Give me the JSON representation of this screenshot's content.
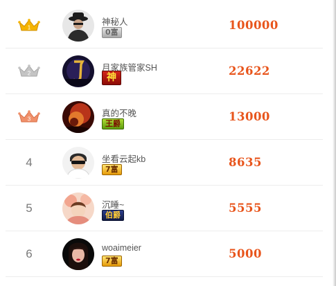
{
  "colors": {
    "score": "#e8551c",
    "rank_text": "#7a7a7a",
    "name_text": "#555555",
    "crown_gold": "#f5b400",
    "crown_silver": "#c4c4c4",
    "crown_bronze": "#f0906a"
  },
  "rows": [
    {
      "rank": "1",
      "rank_icon": "gold-crown-icon",
      "name": "神秘人",
      "badge": "0富",
      "badge_style": "gray",
      "score": "100000"
    },
    {
      "rank": "2",
      "rank_icon": "silver-crown-icon",
      "name": "月家族管家SH",
      "badge": "神",
      "badge_style": "red",
      "score": "22622"
    },
    {
      "rank": "3",
      "rank_icon": "bronze-crown-icon",
      "name": "真的不晚",
      "badge": "王爵",
      "badge_style": "green",
      "score": "13000"
    },
    {
      "rank": "4",
      "rank_icon": "",
      "name": "坐看云起kb",
      "badge": "7富",
      "badge_style": "gold",
      "score": "8635"
    },
    {
      "rank": "5",
      "rank_icon": "",
      "name": "沉睡~",
      "badge": "伯爵",
      "badge_style": "blue",
      "score": "5555"
    },
    {
      "rank": "6",
      "rank_icon": "",
      "name": "woaimeier",
      "badge": "7富",
      "badge_style": "gold",
      "score": "5000"
    }
  ]
}
